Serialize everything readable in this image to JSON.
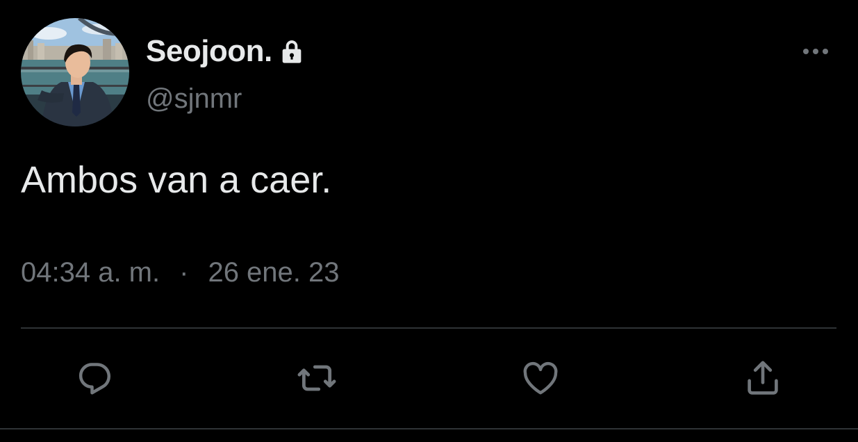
{
  "author": {
    "display_name": "Seojoon.",
    "handle": "@sjnmr",
    "protected": true,
    "avatar_icon": "profile-photo"
  },
  "tweet": {
    "text": "Ambos van a caer.",
    "time": "04:34 a. m.",
    "separator": "·",
    "date": "26 ene. 23"
  },
  "actions": [
    {
      "name": "reply",
      "icon": "comment-bubble-icon"
    },
    {
      "name": "retweet",
      "icon": "retweet-arrows-icon"
    },
    {
      "name": "like",
      "icon": "heart-icon"
    },
    {
      "name": "share",
      "icon": "share-upload-icon"
    }
  ],
  "colors": {
    "background": "#000000",
    "primary_text": "#e7e9ea",
    "secondary_text": "#71767b",
    "divider": "#2f3336"
  }
}
